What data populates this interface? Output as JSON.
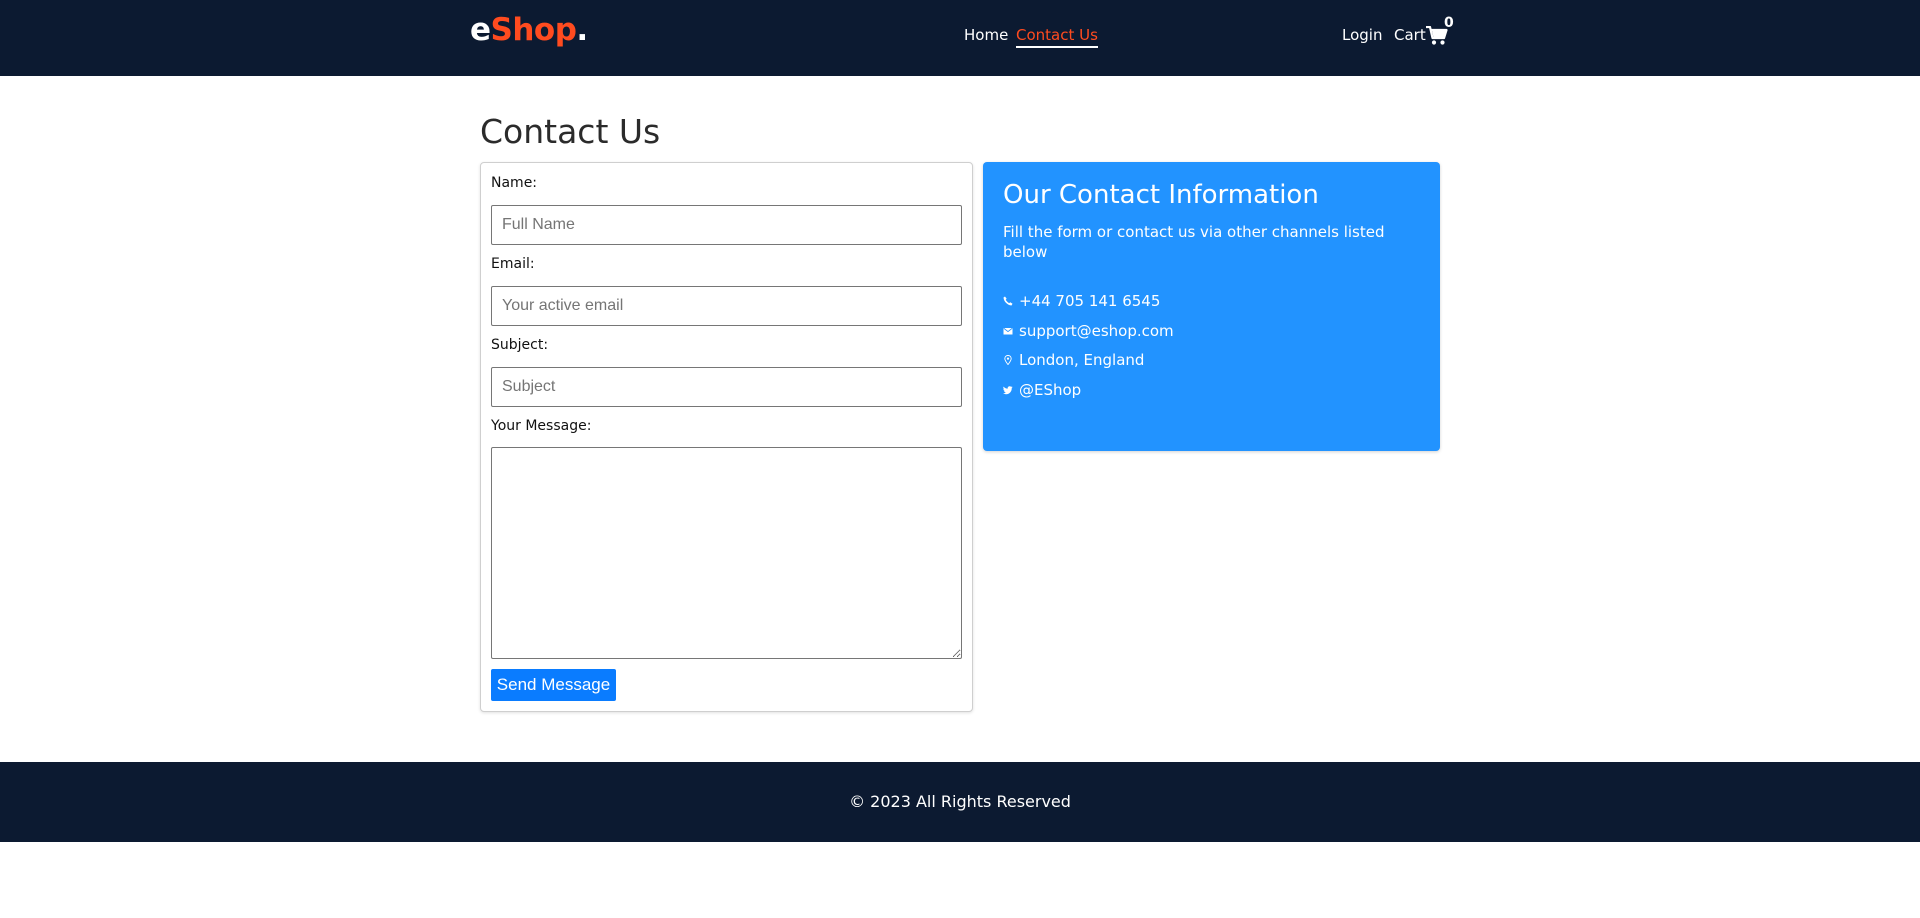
{
  "header": {
    "logo": {
      "part1": "e",
      "part2": "Shop",
      "part3": "."
    },
    "nav": {
      "home": "Home",
      "contact": "Contact Us",
      "login": "Login",
      "cart": "Cart"
    },
    "cart_count": "0"
  },
  "main": {
    "title": "Contact Us",
    "form": {
      "name_label": "Name:",
      "name_placeholder": "Full Name",
      "email_label": "Email:",
      "email_placeholder": "Your active email",
      "subject_label": "Subject:",
      "subject_placeholder": "Subject",
      "message_label": "Your Message:",
      "send_label": "Send Message"
    },
    "info": {
      "title": "Our Contact Information",
      "description": "Fill the form or contact us via other channels listed below",
      "phone": "+44 705 141 6545",
      "email": "support@eshop.com",
      "location": "London, England",
      "twitter": "@EShop"
    }
  },
  "footer": {
    "text": "© 2023 All Rights Reserved"
  },
  "colors": {
    "navy": "#0c1a31",
    "accent": "#ff4b1f",
    "info_blue": "#2293ff",
    "button_blue": "#0a7cff"
  },
  "icons": [
    "cart-icon",
    "phone-icon",
    "mail-icon",
    "location-icon",
    "twitter-icon"
  ]
}
